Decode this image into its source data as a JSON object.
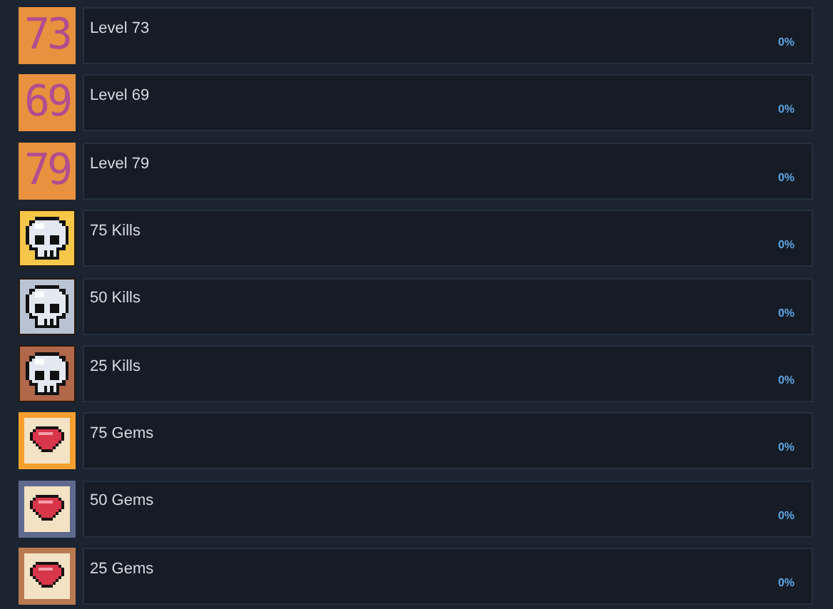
{
  "achievements": [
    {
      "kind": "number",
      "badge": "73",
      "color": "#e8913e",
      "name": "Level 73",
      "progress": "0%"
    },
    {
      "kind": "number",
      "badge": "69",
      "color": "#e8913e",
      "name": "Level 69",
      "progress": "0%"
    },
    {
      "kind": "number",
      "badge": "79",
      "color": "#e8913e",
      "name": "Level 79",
      "progress": "0%"
    },
    {
      "kind": "skull",
      "color": "#f6c648",
      "name": "75 Kills",
      "progress": "0%"
    },
    {
      "kind": "skull",
      "color": "#b9c3d3",
      "name": "50 Kills",
      "progress": "0%"
    },
    {
      "kind": "skull",
      "color": "#b0674a",
      "name": "25 Kills",
      "progress": "0%"
    },
    {
      "kind": "gem",
      "color": "#f5a02e",
      "name": "75 Gems",
      "progress": "0%"
    },
    {
      "kind": "gem",
      "color": "#5f6a8c",
      "name": "50 Gems",
      "progress": "0%"
    },
    {
      "kind": "gem",
      "color": "#b97a52",
      "name": "25 Gems",
      "progress": "0%"
    }
  ]
}
